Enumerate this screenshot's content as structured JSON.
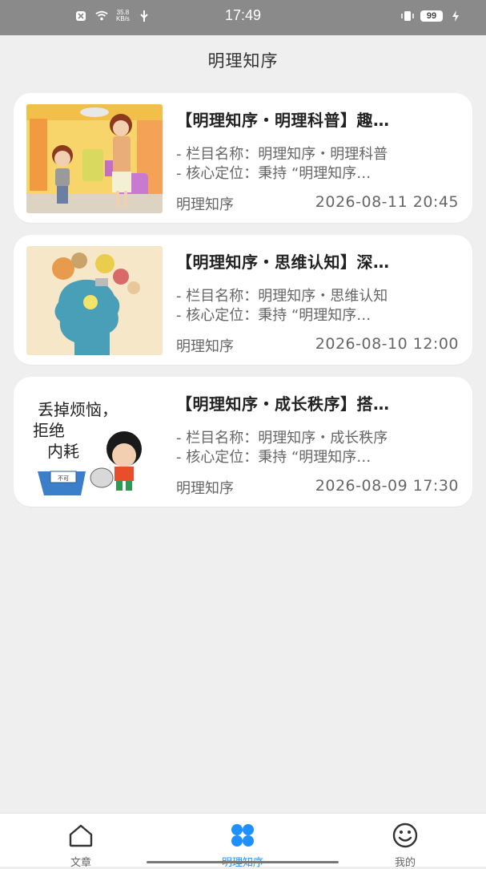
{
  "status_bar": {
    "net_speed": "35.8\nKB/s",
    "time": "17:49",
    "battery": "99"
  },
  "header": {
    "title": "明理知序"
  },
  "articles": [
    {
      "title": "【明理知序・明理科普】趣…",
      "desc1": "- 栏目名称：明理知序・明理科普",
      "desc2": "- 核心定位：秉持 “明理知序…",
      "source": "明理知序",
      "datetime": "2026-08-11 20:45"
    },
    {
      "title": "【明理知序・思维认知】深…",
      "desc1": "- 栏目名称：明理知序・思维认知",
      "desc2": "- 核心定位：秉持 “明理知序…",
      "source": "明理知序",
      "datetime": "2026-08-10 12:00"
    },
    {
      "title": "【明理知序・成长秩序】搭…",
      "desc1": "- 栏目名称：明理知序・成长秩序",
      "desc2": "- 核心定位：秉持 “明理知序…",
      "source": "明理知序",
      "datetime": "2026-08-09 17:30",
      "thumb_text": {
        "line1": "丢掉烦恼，",
        "line2": "拒绝",
        "line3": "内耗",
        "bin": "不可\n回收"
      }
    }
  ],
  "bottom_nav": {
    "items": [
      {
        "label": "文章",
        "icon": "home-icon",
        "active": false
      },
      {
        "label": "明理知序",
        "icon": "grid-icon",
        "active": true
      },
      {
        "label": "我的",
        "icon": "smile-icon",
        "active": false
      }
    ]
  },
  "colors": {
    "active": "#1e90ff",
    "status_bar": "#8a8a8a",
    "background": "#efefef"
  }
}
